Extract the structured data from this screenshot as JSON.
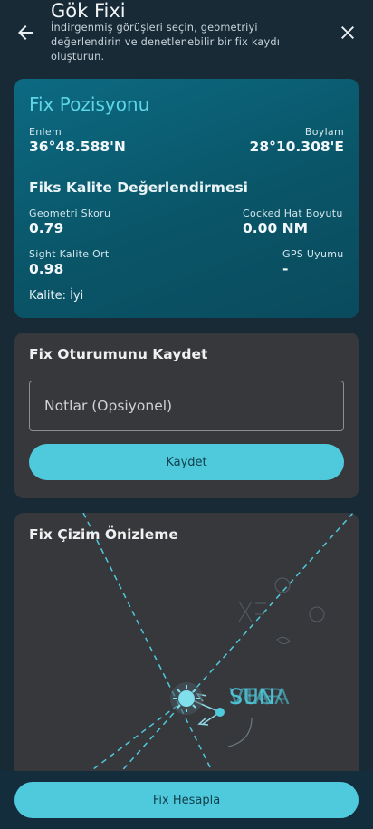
{
  "header": {
    "title": "Gök Fixi",
    "subtitle": "İndirgenmiş görüşleri seçin, geometriyi değerlendirin ve denetlenebilir bir fix kaydı oluşturun."
  },
  "fix_position": {
    "title": "Fix Pozisyonu",
    "lat_label": "Enlem",
    "lat_value": "36°48.588'N",
    "lon_label": "Boylam",
    "lon_value": "28°10.308'E"
  },
  "quality": {
    "title": "Fiks Kalite Değerlendirmesi",
    "geometry_label": "Geometri Skoru",
    "geometry_value": "0.79",
    "cocked_hat_label": "Cocked Hat Boyutu",
    "cocked_hat_value": "0.00 NM",
    "sight_label": "Sight Kalite Ort",
    "sight_value": "0.98",
    "gps_label": "GPS Uyumu",
    "gps_value": "-",
    "summary": "Kalite: İyi"
  },
  "save": {
    "title": "Fix Oturumunu Kaydet",
    "notes_placeholder": "Notlar (Opsiyonel)",
    "notes_value": "",
    "button_label": "Kaydet"
  },
  "preview": {
    "title": "Fix Çizim Önizleme",
    "overlap_label_a": "SUN",
    "overlap_label_b": "VEGA",
    "overlap_label_c": "STAR"
  },
  "footer": {
    "calc_button_label": "Fix Hesapla"
  },
  "colors": {
    "background": "#172a36",
    "accent": "#4fc9dc",
    "card_dark": "#37383c",
    "fix_card": "#0a5568",
    "lop_line": "#4fc9dc"
  },
  "icons": {
    "back": "arrow-left-icon",
    "close": "close-icon",
    "fix_marker": "sun-icon"
  }
}
